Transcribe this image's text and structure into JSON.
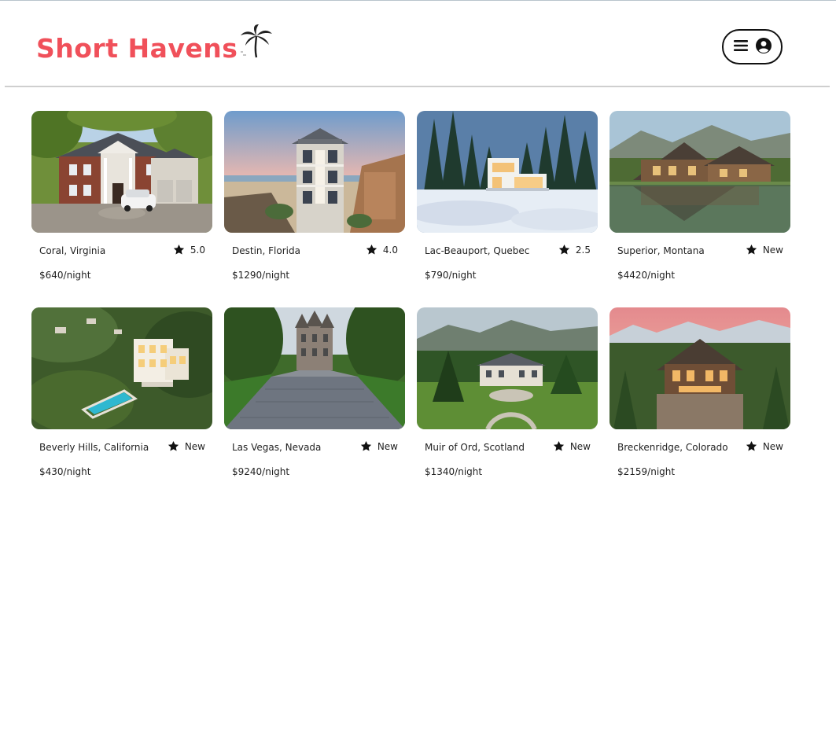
{
  "brand": {
    "name": "Short Havens",
    "color": "#f0505a"
  },
  "header": {
    "menu_icon": "hamburger-icon",
    "user_icon": "user-circle-icon"
  },
  "listings": [
    {
      "location": "Coral, Virginia",
      "rating": "5.0",
      "price": "$640/night",
      "photo": "brick-colonial-house"
    },
    {
      "location": "Destin, Florida",
      "rating": "4.0",
      "price": "$1290/night",
      "photo": "beach-house-sunset"
    },
    {
      "location": "Lac-Beauport, Quebec",
      "rating": "2.5",
      "price": "$790/night",
      "photo": "modern-cabin-snow"
    },
    {
      "location": "Superior, Montana",
      "rating": "New",
      "price": "$4420/night",
      "photo": "lodge-by-lake"
    },
    {
      "location": "Beverly Hills, California",
      "rating": "New",
      "price": "$430/night",
      "photo": "hillside-mansion-pool"
    },
    {
      "location": "Las Vegas, Nevada",
      "rating": "New",
      "price": "$9240/night",
      "photo": "castle-driveway"
    },
    {
      "location": "Muir of Ord, Scotland",
      "rating": "New",
      "price": "$1340/night",
      "photo": "estate-valley"
    },
    {
      "location": "Breckenridge, Colorado",
      "rating": "New",
      "price": "$2159/night",
      "photo": "mountain-log-mansion"
    }
  ]
}
